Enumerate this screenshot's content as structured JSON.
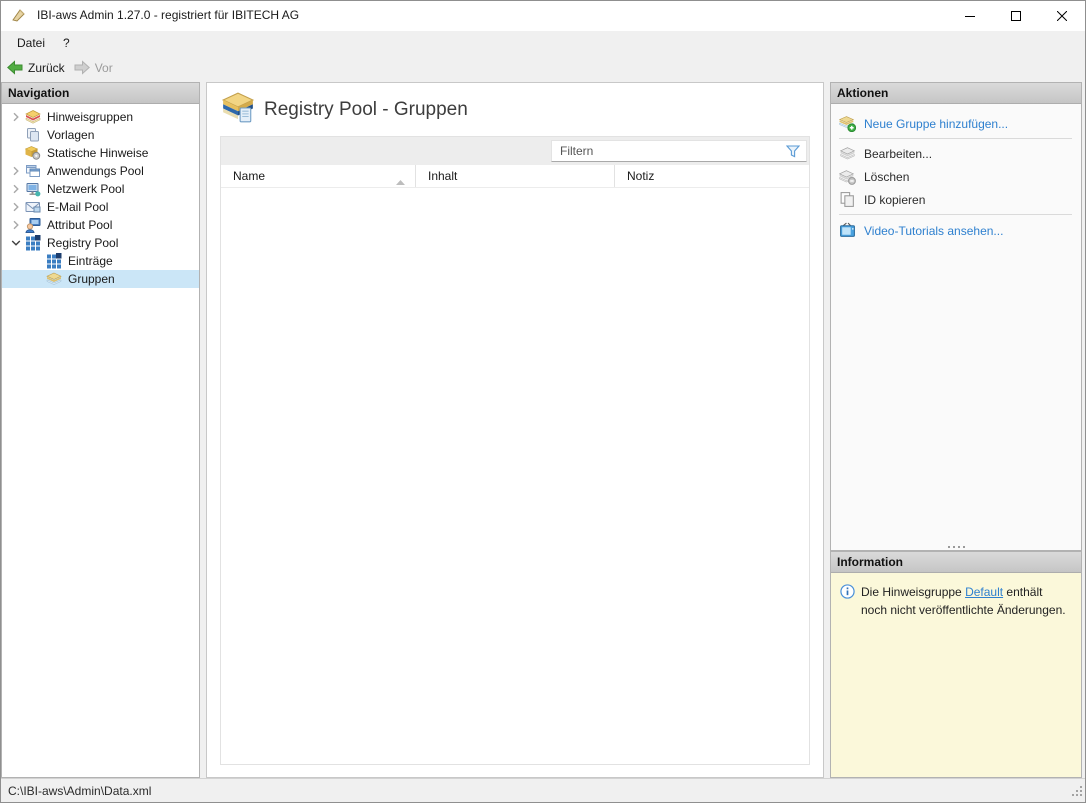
{
  "window": {
    "title": "IBI-aws Admin 1.27.0 - registriert für IBITECH AG",
    "controls": [
      {
        "name": "minimize"
      },
      {
        "name": "maximize"
      },
      {
        "name": "close"
      }
    ]
  },
  "menu": {
    "items": [
      {
        "label": "Datei"
      },
      {
        "label": "?"
      }
    ]
  },
  "toolbar": {
    "back_label": "Zurück",
    "forward_label": "Vor"
  },
  "navigation": {
    "header": "Navigation",
    "items": [
      {
        "label": "Hinweisgruppen",
        "icon": "notice-group-icon",
        "state": "collapsed"
      },
      {
        "label": "Vorlagen",
        "icon": "templates-icon",
        "state": "leaf"
      },
      {
        "label": "Statische Hinweise",
        "icon": "static-notice-icon",
        "state": "leaf"
      },
      {
        "label": "Anwendungs Pool",
        "icon": "application-pool-icon",
        "state": "collapsed"
      },
      {
        "label": "Netzwerk Pool",
        "icon": "network-pool-icon",
        "state": "collapsed"
      },
      {
        "label": "E-Mail Pool",
        "icon": "email-pool-icon",
        "state": "collapsed"
      },
      {
        "label": "Attribut Pool",
        "icon": "attribute-pool-icon",
        "state": "collapsed"
      },
      {
        "label": "Registry Pool",
        "icon": "registry-pool-icon",
        "state": "expanded"
      },
      {
        "label": "Einträge",
        "icon": "registry-entries-icon",
        "state": "leaf-child"
      },
      {
        "label": "Gruppen",
        "icon": "groups-icon",
        "state": "leaf-child",
        "selected": true
      }
    ]
  },
  "main": {
    "title": "Registry Pool - Gruppen",
    "filter_placeholder": "Filtern",
    "columns": [
      {
        "label": "Name",
        "sorted": "asc"
      },
      {
        "label": "Inhalt"
      },
      {
        "label": "Notiz"
      }
    ],
    "rows": []
  },
  "actions": {
    "header": "Aktionen",
    "items": [
      {
        "label": "Neue Gruppe hinzufügen...",
        "icon": "add-group-icon",
        "style": "link"
      },
      {
        "label": "Bearbeiten...",
        "icon": "edit-group-icon",
        "style": "normal"
      },
      {
        "label": "Löschen",
        "icon": "delete-group-icon",
        "style": "normal"
      },
      {
        "label": "ID kopieren",
        "icon": "copy-id-icon",
        "style": "normal"
      },
      {
        "label": "Video-Tutorials ansehen...",
        "icon": "video-tutorials-icon",
        "style": "link"
      }
    ]
  },
  "information": {
    "header": "Information",
    "message_before": "Die Hinweisgruppe ",
    "message_link": "Default",
    "message_after": " enthält noch nicht veröffentlichte Änderungen."
  },
  "statusbar": {
    "path": "C:\\IBI-aws\\Admin\\Data.xml"
  },
  "colors": {
    "link": "#2e80cf",
    "selection_bg": "#cbe6f7",
    "info_panel_bg": "#fbf8da"
  }
}
